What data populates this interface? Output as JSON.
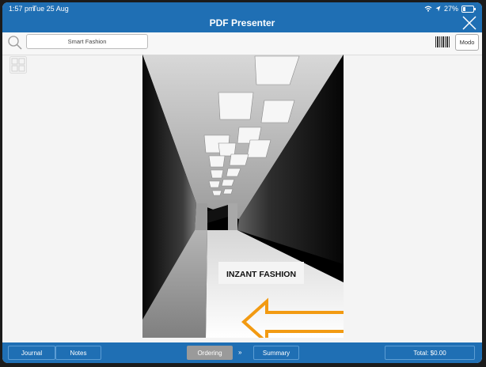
{
  "status": {
    "time": "1:57 pm",
    "date": "Tue 25 Aug",
    "battery": "27%",
    "battery_level": 0.27
  },
  "header": {
    "title": "PDF Presenter"
  },
  "toolbar": {
    "search_value": "Smart Fashion",
    "mode_label": "Modo"
  },
  "document": {
    "caption": "INZANT FASHION"
  },
  "bottom": {
    "journal": "Journal",
    "notes": "Notes",
    "ordering": "Ordering",
    "separator": "»",
    "summary": "Summary",
    "total": "Total: $0.00"
  },
  "colors": {
    "brand": "#1f6fb4",
    "arrow": "#f29a12",
    "active_tab": "#9a9a9a"
  },
  "icons": [
    "search-icon",
    "close-icon",
    "barcode-icon",
    "grid-icon",
    "wifi-icon",
    "location-icon",
    "battery-icon"
  ]
}
